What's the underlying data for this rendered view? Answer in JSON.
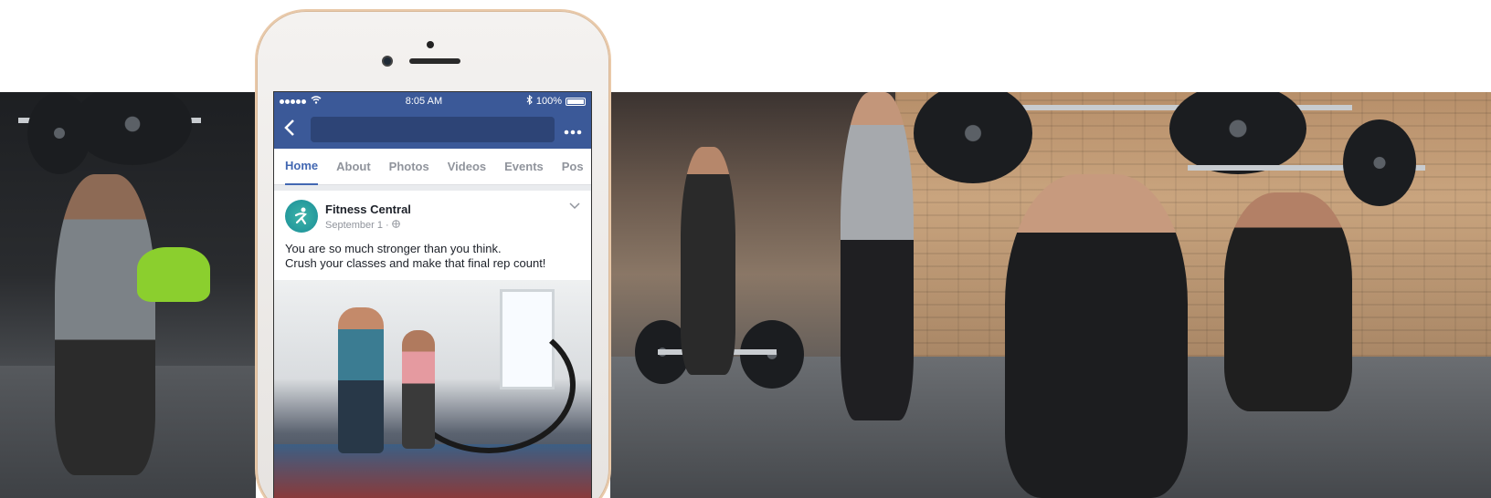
{
  "status_bar": {
    "time": "8:05 AM",
    "battery": "100%"
  },
  "tabs": [
    {
      "label": "Home",
      "active": true
    },
    {
      "label": "About",
      "active": false
    },
    {
      "label": "Photos",
      "active": false
    },
    {
      "label": "Videos",
      "active": false
    },
    {
      "label": "Events",
      "active": false
    },
    {
      "label": "Pos",
      "active": false
    }
  ],
  "post": {
    "page_name": "Fitness Central",
    "date": "September 1 · ",
    "text_line_1": "You are so much stronger than you think.",
    "text_line_2": "Crush your classes and make that final rep count!"
  },
  "colors": {
    "facebook_blue": "#3b5998",
    "accent": "#4267b2"
  }
}
